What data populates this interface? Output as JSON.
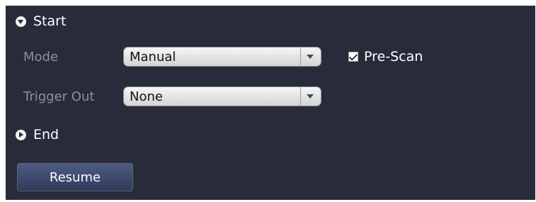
{
  "start_section": {
    "title": "Start",
    "icon": "collapse-circle-icon",
    "expanded": true
  },
  "mode": {
    "label": "Mode",
    "value": "Manual"
  },
  "prescan": {
    "label": "Pre-Scan",
    "checked": true
  },
  "trigger_out": {
    "label": "Trigger Out",
    "value": "None"
  },
  "end_section": {
    "title": "End",
    "icon": "expand-circle-icon",
    "expanded": false
  },
  "resume_button": {
    "label": "Resume"
  },
  "colors": {
    "panel_background": "#282b3a",
    "label_text": "#8d909c",
    "button_accent": "#3d4a6e"
  }
}
